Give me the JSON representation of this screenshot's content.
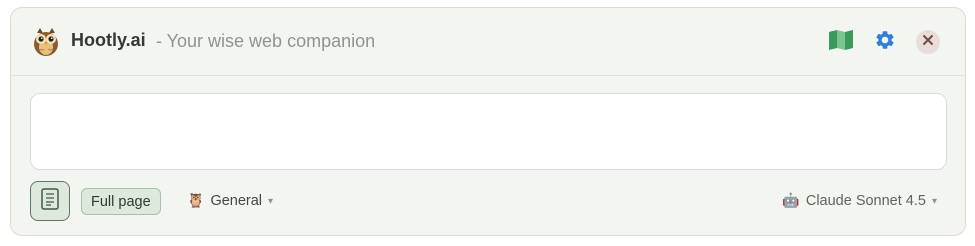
{
  "header": {
    "app_name": "Hootly.ai",
    "tagline": "- Your wise web companion",
    "logo_icon": "owl-logo",
    "actions": [
      {
        "name": "book-icon",
        "color": "#3a9a5b"
      },
      {
        "name": "gear-icon",
        "color": "#2f7fd8"
      },
      {
        "name": "close-icon",
        "color": "#6b4e45"
      }
    ]
  },
  "composer": {
    "value": "",
    "placeholder": ""
  },
  "footer": {
    "page_toggle_icon": "document-icon",
    "context_chip": "Full page",
    "mode": {
      "icon": "🦉",
      "label": "General",
      "caret": "▾"
    },
    "model": {
      "icon": "🤖",
      "label": "Claude Sonnet 4.5",
      "caret": "▾"
    }
  },
  "colors": {
    "panel_bg": "#f3f5f1",
    "accent_green": "#5b7a62",
    "chip_bg": "#dde9dd"
  }
}
